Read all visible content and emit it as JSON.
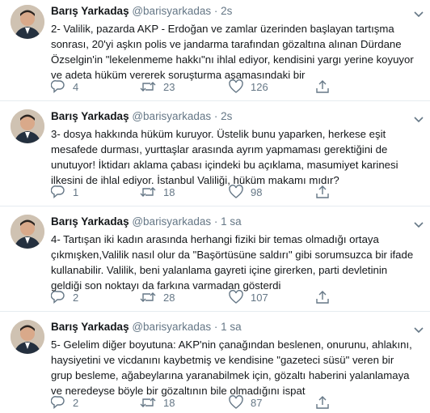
{
  "tweets": [
    {
      "author": "Barış Yarkadaş",
      "handle": "@barisyarkadas",
      "separator": "·",
      "time": "2s",
      "lines": [
        "2- Valilik, pazarda AKP - Erdoğan ve zamlar üzerinden başlayan tartışma",
        "sonrası, 20'yi aşkın polis ve jandarma tarafından gözaltına alınan Dürdane",
        "Özselgin'in \"lekelenmeme hakkı\"nı ihlal ediyor, kendisini yargı yerine koyuyor",
        "ve adeta hüküm vererek soruşturma aşamasındaki bir"
      ],
      "replies": "4",
      "retweets": "23",
      "likes": "126"
    },
    {
      "author": "Barış Yarkadaş",
      "handle": "@barisyarkadas",
      "separator": "·",
      "time": "2s",
      "lines": [
        "3- dosya hakkında hüküm kuruyor. Üstelik bunu yaparken, herkese eşit",
        "mesafede durması, yurttaşlar arasında ayrım yapmaması gerektiğini de",
        "unutuyor! İktidarı aklama çabası içindeki bu açıklama, masumiyet karinesi",
        "ilkesini de ihlal ediyor. İstanbul Valiliği, hüküm makamı mıdır?"
      ],
      "replies": "1",
      "retweets": "18",
      "likes": "98"
    },
    {
      "author": "Barış Yarkadaş",
      "handle": "@barisyarkadas",
      "separator": "·",
      "time": "1 sa",
      "lines": [
        "4- Tartışan iki kadın arasında herhangi fiziki bir temas olmadığı ortaya",
        "çıkmışken,Valilik nasıl olur da \"Başörtüsüne saldırı\" gibi sorumsuzca bir ifade",
        "kullanabilir. Valilik, beni yalanlama gayreti içine girerken, parti devletinin",
        "geldiği son noktayı da farkına varmadan gösterdi"
      ],
      "replies": "2",
      "retweets": "28",
      "likes": "107"
    },
    {
      "author": "Barış Yarkadaş",
      "handle": "@barisyarkadas",
      "separator": "·",
      "time": "1 sa",
      "lines": [
        "5- Gelelim diğer boyutuna: AKP'nin çanağından beslenen, onurunu, ahlakını,",
        "haysiyetini ve vicdanını kaybetmiş ve kendisine \"gazeteci süsü\" veren bir",
        "grup besleme, ağabeylarına yaranabilmek için, gözaltı haberini yalanlamaya",
        "ve neredeyse böyle bir gözaltının bile olmadığını ispat"
      ],
      "replies": "2",
      "retweets": "18",
      "likes": "87"
    }
  ],
  "icons": {
    "reply": "reply-icon",
    "retweet": "retweet-icon",
    "like": "heart-icon",
    "share": "share-icon",
    "caret": "chevron-down-icon"
  },
  "colors": {
    "text": "#14171a",
    "secondary": "#657786",
    "divider": "#e6ecf0"
  }
}
